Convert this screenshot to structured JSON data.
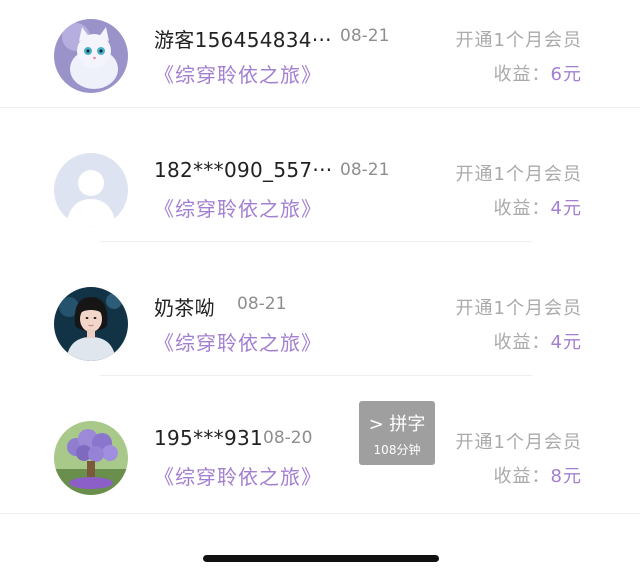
{
  "rows": [
    {
      "avatar": "white-cat-avatar",
      "name": "游客156454834···",
      "date": "08-21",
      "book": "《综穿聆依之旅》",
      "action": "开通1个月会员",
      "income_label": "收益：",
      "income_value": "6元"
    },
    {
      "avatar": "default-user-avatar",
      "name": "182***090_557···",
      "date": "08-21",
      "book": "《综穿聆依之旅》",
      "action": "开通1个月会员",
      "income_label": "收益：",
      "income_value": "4元"
    },
    {
      "avatar": "girl-portrait-avatar",
      "name": "奶茶呦",
      "date": "08-21",
      "book": "《综穿聆依之旅》",
      "action": "开通1个月会员",
      "income_label": "收益：",
      "income_value": "4元"
    },
    {
      "avatar": "purple-flowers-avatar",
      "name": "195***931",
      "date": "08-20",
      "book": "《综穿聆依之旅》",
      "action": "开通1个月会员",
      "income_label": "收益：",
      "income_value": "8元"
    }
  ],
  "overlay": {
    "icon": "chevron-right-icon",
    "label": "拼字",
    "duration": "108分钟"
  },
  "colors": {
    "accent": "#a37fd1",
    "muted": "#aaaaaa",
    "overlay_bg": "#9f9f9f"
  }
}
